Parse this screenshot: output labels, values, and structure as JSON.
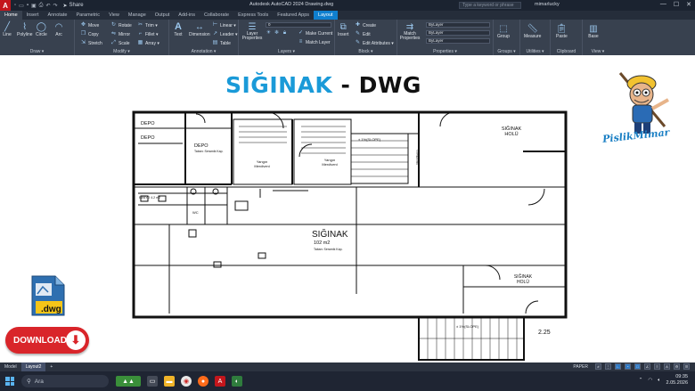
{
  "titlebar": {
    "logo": "A",
    "qat_icons": [
      "new-icon",
      "open-icon",
      "save-icon",
      "saveas-icon",
      "print-icon",
      "undo-icon",
      "redo-icon"
    ],
    "share_label": "Share",
    "app_title": "Autodesk AutoCAD 2024   Drawing.dwg",
    "search_placeholder": "Type a keyword or phrase",
    "user": "mimarlucky",
    "window_controls": [
      "—",
      "☐",
      "✕"
    ]
  },
  "tabs": [
    "Home",
    "Insert",
    "Annotate",
    "Parametric",
    "View",
    "Manage",
    "Output",
    "Add-ins",
    "Collaborate",
    "Express Tools",
    "Featured Apps",
    "Layout"
  ],
  "ribbon": {
    "draw": {
      "title": "Draw ▾",
      "buttons": [
        "Line",
        "Polyline",
        "Circle",
        "Arc"
      ]
    },
    "modify": {
      "title": "Modify ▾",
      "items": [
        "Move",
        "Rotate",
        "Trim ▾",
        "Copy",
        "Mirror",
        "Fillet ▾",
        "Stretch",
        "Scale",
        "Array ▾"
      ]
    },
    "annotation": {
      "title": "Annotation ▾",
      "text": "Text",
      "dimension": "Dimension",
      "items": [
        "Linear ▾",
        "Leader ▾",
        "Table"
      ]
    },
    "layers": {
      "title": "Layers ▾",
      "properties": "Layer Properties",
      "layer_combo": "0",
      "items": [
        "Make Current",
        "Match Layer"
      ]
    },
    "block": {
      "title": "Block ▾",
      "insert": "Insert",
      "items": [
        "Create",
        "Edit",
        "Edit Attributes ▾"
      ]
    },
    "properties": {
      "title": "Properties ▾",
      "match": "Match Properties",
      "combos": [
        "ByLayer",
        "ByLayer",
        "ByLayer"
      ]
    },
    "groups": {
      "title": "Groups ▾",
      "label": "Group"
    },
    "utilities": {
      "title": "Utilities ▾",
      "label": "Measure"
    },
    "clipboard": {
      "title": "Clipboard",
      "label": "Paste"
    },
    "view": {
      "title": "View ▾",
      "label": "Base"
    }
  },
  "drawing": {
    "title_part1": "SIĞINAK",
    "title_part2": " - DWG",
    "rooms": {
      "depo1": "DEPO",
      "depo2": "DEPO",
      "depo3": "DEPO",
      "small_notes": "Taban: Seramik Kap.",
      "yangin1": "Yangın Merdiveni",
      "yangin2": "Yangın Merdiveni",
      "siginak_holu_top": "SIĞINAK HOLÜ",
      "siginak_main": "SIĞINAK",
      "siginak_area": "102 m2",
      "siginak_notes": "Taban: Seramik Kap.",
      "siginak_holu_bottom": "SIĞINAK HOLÜ",
      "banyo": "BANYO 4.2 m2",
      "wc": "WC",
      "merdiven": "Merdiven",
      "level_top": "± 1%(SLOPE)",
      "level_bottom": "± 1%(SLOPE)",
      "dim": "2.25"
    },
    "brand": "PislikMimar",
    "file_badge": ".dwg",
    "download_label": "DOWNLOAD"
  },
  "layoutbar": {
    "tabs": [
      "Model",
      "Layout2"
    ],
    "add": "+",
    "paper": "PAPER",
    "status_icons": [
      "grid",
      "snap",
      "ortho",
      "polar",
      "osnap",
      "otrack",
      "lineweight",
      "annotation",
      "workspace",
      "settings"
    ]
  },
  "taskbar": {
    "search": "Ara",
    "time": "09:35",
    "date": "2.05.2026",
    "tray_icons": [
      "chevron-up-icon",
      "wifi-icon",
      "speaker-icon"
    ]
  },
  "colors": {
    "accent": "#0f7fcf",
    "title_blue": "#1a9ad8",
    "download_red": "#d9252a",
    "ribbon_bg": "#38414f"
  }
}
